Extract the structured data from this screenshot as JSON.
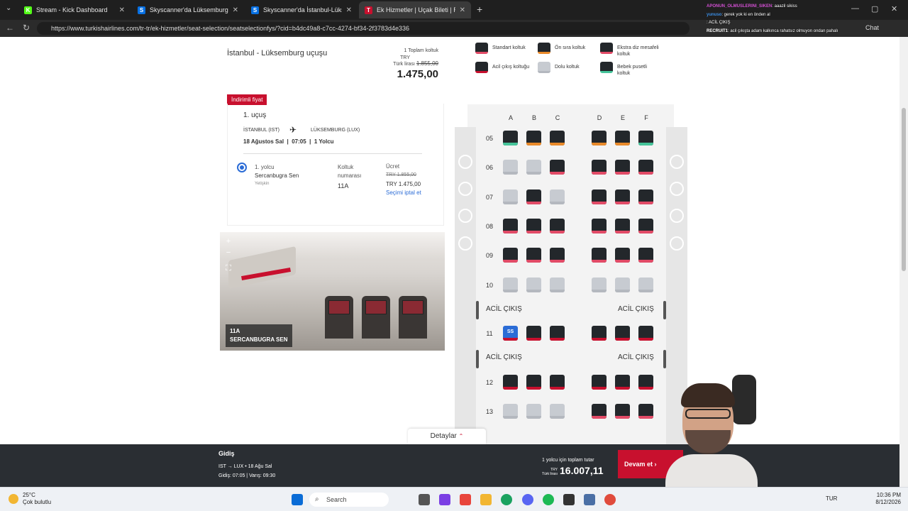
{
  "browser": {
    "tabs": [
      {
        "title": "Stream - Kick Dashboard",
        "active": false,
        "fav_color": "#53fc18",
        "fav_glyph": "K"
      },
      {
        "title": "Skyscanner'da Lüksemburg bölge...",
        "active": false,
        "fav_color": "#0770e3",
        "fav_glyph": "S"
      },
      {
        "title": "Skyscanner'da İstanbul-Lüksemb...",
        "active": false,
        "fav_color": "#0770e3",
        "fav_glyph": "S"
      },
      {
        "title": "Ek Hizmetler | Uçak Bileti | Rezerv...",
        "active": true,
        "fav_color": "#c8102e",
        "fav_glyph": "T"
      }
    ],
    "url": "https://www.turkishairlines.com/tr-tr/ek-hizmetler/seat-selection/seatselectionfys/?cid=b4dc49a8-c7cc-4274-bf34-2f3783d4e336",
    "chat_button": "Chat"
  },
  "booking": {
    "route_title": "İstanbul - Lüksemburg uçuşu",
    "total_seat_label": "1 Toplam koltuk",
    "currency_label": "TRY",
    "currency_sub": "Türk lirası",
    "old_price": "1.855,00",
    "new_price": "1.475,00",
    "discount_tag": "İndirimli fiyat",
    "flight_no": "1. uçuş",
    "from_city": "İSTANBUL (IST)",
    "to_city": "LÜKSEMBURG (LUX)",
    "date": "18 Ağustos Sal",
    "time": "07:05",
    "pax_count": "1 Yolcu",
    "pax_label": "1. yolcu",
    "pax_name": "Sercanbugra Sen",
    "pax_type": "Yetişkin",
    "seat_header": "Koltuk numarası",
    "seat_value": "11A",
    "fee_header": "Ücret",
    "fee_old": "TRY 1.855,00",
    "fee_new": "TRY 1.475,00",
    "cancel_link": "Seçimi iptal et"
  },
  "panorama": {
    "seat": "11A",
    "name": "SERCANBUGRA SEN",
    "zoom_in": "+",
    "zoom_out": "−",
    "fullscreen": "⛶"
  },
  "legend": [
    {
      "label": "Standart koltuk",
      "type": "std"
    },
    {
      "label": "Ön sıra koltuk",
      "type": "front"
    },
    {
      "label": "Ekstra diz mesafeli koltuk",
      "type": "extra"
    },
    {
      "label": "Acil çıkış koltuğu",
      "type": "exit"
    },
    {
      "label": "Dolu koltuk",
      "type": "occ"
    },
    {
      "label": "Bebek pusetli koltuk",
      "type": "baby"
    }
  ],
  "seatmap": {
    "columns": [
      "A",
      "B",
      "C",
      "D",
      "E",
      "F"
    ],
    "rows": [
      {
        "no": "05",
        "seats": [
          "baby",
          "front",
          "front",
          "front",
          "front",
          "baby"
        ]
      },
      {
        "no": "06",
        "seats": [
          "occ",
          "occ",
          "std",
          "std",
          "std",
          "std"
        ]
      },
      {
        "no": "07",
        "seats": [
          "occ",
          "std",
          "occ",
          "std",
          "std",
          "std"
        ]
      },
      {
        "no": "08",
        "seats": [
          "std",
          "std",
          "std",
          "std",
          "std",
          "std"
        ]
      },
      {
        "no": "09",
        "seats": [
          "std",
          "std",
          "std",
          "std",
          "std",
          "std"
        ]
      },
      {
        "no": "10",
        "seats": [
          "occ",
          "occ",
          "occ",
          "occ",
          "occ",
          "occ"
        ]
      },
      {
        "no": "11",
        "seats": [
          "sel",
          "exit",
          "exit",
          "exit",
          "exit",
          "exit"
        ]
      },
      {
        "no": "12",
        "seats": [
          "exit",
          "exit",
          "exit",
          "exit",
          "exit",
          "exit"
        ]
      },
      {
        "no": "13",
        "seats": [
          "occ",
          "occ",
          "occ",
          "std",
          "std",
          "std"
        ]
      }
    ],
    "exit_label": "ACİL ÇIKIŞ",
    "selected_initials": "SS"
  },
  "details_tab": "Detaylar",
  "bottom_bar": {
    "gidis": "Gidiş",
    "route": "IST → LUX • 18 Ağu Sal",
    "time": "Gidiş: 07:05 | Varış: 09:30",
    "total_label": "1 yolcu için toplam tutar",
    "currency": "TRY",
    "currency_sub": "Türk lirası",
    "total": "16.007,11",
    "continue": "Devam et"
  },
  "chat": [
    {
      "user": "APONUN_OLMUSLERINI_SIKEN",
      "msg": ": aaazil sikiss",
      "color": "#d14fd1"
    },
    {
      "user": "yunuso",
      "msg": ": gerek yok ki en önden al",
      "color": "#3a8ee6"
    },
    {
      "user": "",
      "msg": ": ACİL ÇIKIŞ",
      "color": "#ffffff"
    },
    {
      "user": "RECRUIT1",
      "msg": ": acil çıkışta adam kalkınca rahatsız olmuyon ondan pahalı",
      "color": "#ffffff"
    },
    {
      "user": "",
      "msg": "",
      "color": "#ffffff"
    },
    {
      "user": "",
      "msg": "",
      "color": "#ffffff"
    },
    {
      "user": "",
      "msg": "",
      "color": "#ffffff"
    },
    {
      "user": "",
      "msg": "",
      "color": "#ffffff"
    },
    {
      "user": "",
      "msg": "",
      "color": "#ffffff"
    },
    {
      "user": "",
      "msg": "",
      "color": "#ffffff"
    },
    {
      "user": "",
      "msg": "",
      "color": "#ffffff"
    },
    {
      "user": "",
      "msg": "",
      "color": "#ffffff"
    },
    {
      "user": "",
      "msg": "",
      "color": "#ffffff"
    },
    {
      "user": "",
      "msg": "",
      "color": "#ffffff"
    }
  ],
  "taskbar": {
    "temp": "25°C",
    "weather": "Çok bulutlu",
    "search": "Search",
    "lang": "TUR",
    "time": "10:36 PM",
    "date": "8/12/2026"
  }
}
